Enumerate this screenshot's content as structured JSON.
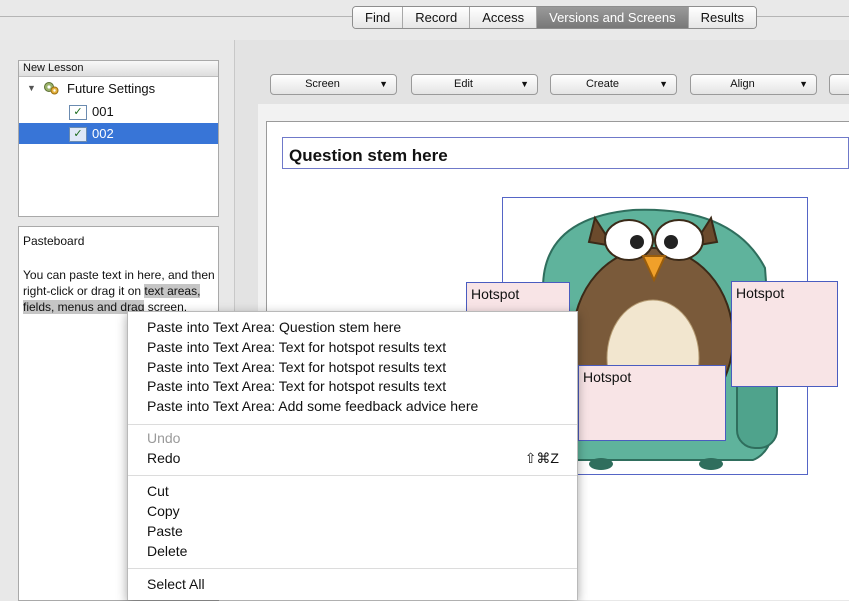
{
  "tabs": [
    "Find",
    "Record",
    "Access",
    "Versions and Screens",
    "Results"
  ],
  "tree": {
    "header": "New Lesson",
    "root": "Future Settings",
    "items": [
      "001",
      "002"
    ]
  },
  "pasteboard": {
    "title": "Pasteboard",
    "text_before": "You can paste text in here, and then right-click or drag it on ",
    "text_highlight": "text areas, fields, menus and drag",
    "text_after": " screen."
  },
  "toolbar": {
    "screen": "Screen",
    "edit": "Edit",
    "create": "Create",
    "align": "Align"
  },
  "canvas": {
    "question_stem": "Question stem here",
    "hotspot_label": "Hotspot"
  },
  "context_menu": {
    "paste_items": [
      "Paste into Text Area: Question stem here",
      "Paste into Text Area: Text for hotspot results text",
      "Paste into Text Area: Text for hotspot results text",
      "Paste into Text Area: Text for hotspot results text",
      "Paste into Text Area: Add some feedback advice here"
    ],
    "undo": "Undo",
    "redo": "Redo",
    "redo_shortcut": "⇧⌘Z",
    "cut": "Cut",
    "copy": "Copy",
    "paste": "Paste",
    "delete": "Delete",
    "select_all": "Select All"
  },
  "colors": {
    "selection": "#3875d7",
    "hotspot_fill": "#f8e4e6",
    "hotspot_border": "#4a5cc0"
  }
}
